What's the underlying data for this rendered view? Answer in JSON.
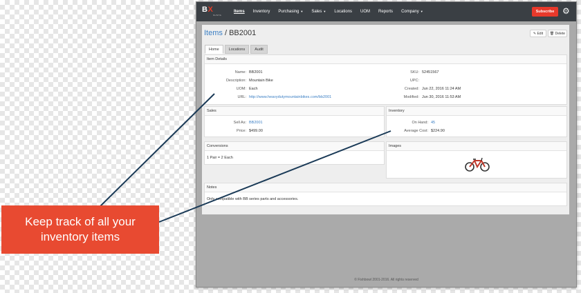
{
  "app": {
    "logo_text": "B",
    "logo_x": "X",
    "logo_sub": "SUSTA",
    "subscribe_label": "Subscribe",
    "gear_icon": "gear-icon"
  },
  "nav": {
    "items": [
      "Items",
      "Inventory",
      "Purchasing",
      "Sales",
      "Locations",
      "UOM",
      "Reports",
      "Company"
    ]
  },
  "page": {
    "breadcrumb_root": "Items",
    "breadcrumb_sep": " / ",
    "item_code": "BB2001",
    "edit_label": "✎ Edit",
    "delete_label": "🗑 Delete",
    "tabs": [
      "Home",
      "Locations",
      "Audit"
    ]
  },
  "item_details": {
    "title": "Item Details",
    "name_label": "Name:",
    "name": "BB2001",
    "desc_label": "Description:",
    "desc": "Mountain Bike",
    "uom_label": "UOM:",
    "uom": "Each",
    "url_label": "URL:",
    "url": "http://www.heavydutymountainbikes.com/bb2001",
    "sku_label": "SKU:",
    "sku": "52451567",
    "upc_label": "UPC:",
    "upc": "",
    "created_label": "Created:",
    "created": "Jun 22, 2016 11:24 AM",
    "modified_label": "Modified:",
    "modified": "Jun 30, 2016 11:53 AM"
  },
  "sales": {
    "title": "Sales",
    "sell_as_label": "Sell As:",
    "sell_as": "BB2001",
    "price_label": "Price:",
    "price": "$499.00"
  },
  "inventory": {
    "title": "Inventory",
    "on_hand_label": "On Hand:",
    "on_hand": "45",
    "avg_cost_label": "Average Cost:",
    "avg_cost": "$224.90"
  },
  "conversions": {
    "title": "Conversions",
    "text": "1 Pair = 2 Each"
  },
  "images": {
    "title": "Images",
    "icon": "bike-icon"
  },
  "notes": {
    "title": "Notes",
    "text": "Only compatible with BB series parts and accessories."
  },
  "footer": {
    "text": "© Fishbowl 2001-2016. All rights reserved"
  },
  "callout": {
    "text": "Keep track of all your inventory items",
    "color": "#e84a31"
  }
}
